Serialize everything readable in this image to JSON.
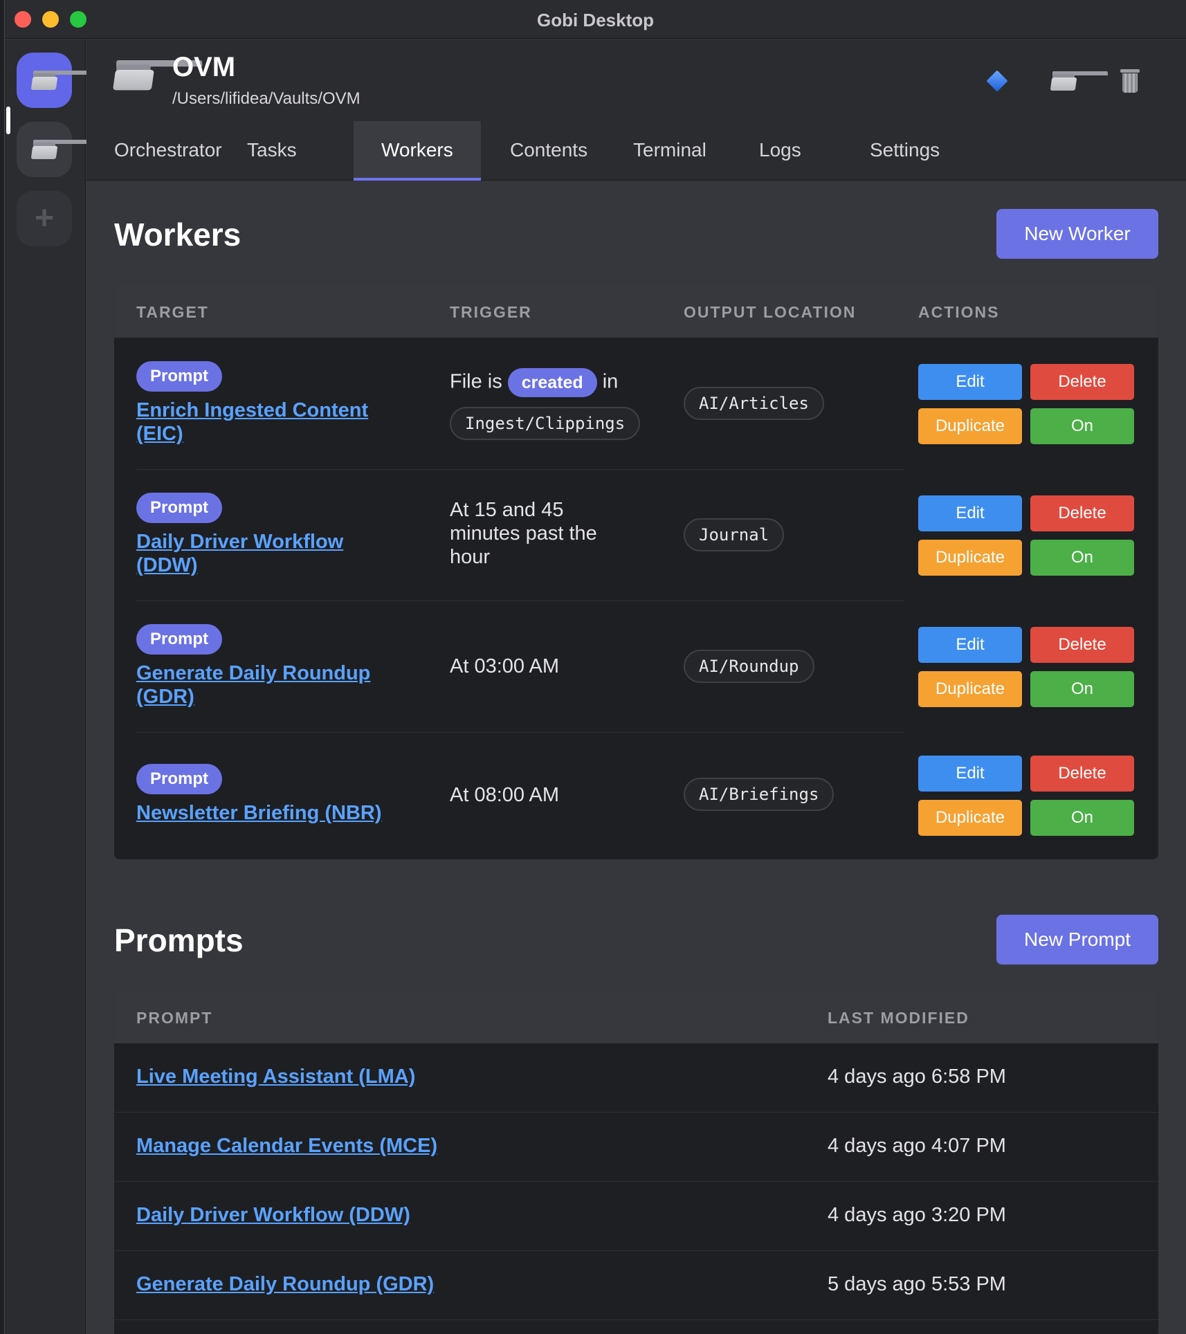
{
  "window": {
    "title": "Gobi Desktop"
  },
  "header": {
    "vault_name": "OVM",
    "vault_path": "/Users/lifidea/Vaults/OVM"
  },
  "tabs": [
    {
      "label": "Orchestrator"
    },
    {
      "label": "Tasks"
    },
    {
      "label": "Workers"
    },
    {
      "label": "Contents"
    },
    {
      "label": "Terminal"
    },
    {
      "label": "Logs"
    },
    {
      "label": "Settings"
    }
  ],
  "workers": {
    "title": "Workers",
    "new_button": "New Worker",
    "columns": {
      "target": "TARGET",
      "trigger": "TRIGGER",
      "output": "OUTPUT LOCATION",
      "actions": "ACTIONS"
    },
    "action_labels": {
      "edit": "Edit",
      "delete": "Delete",
      "duplicate": "Duplicate",
      "toggle": "On"
    },
    "rows": [
      {
        "type": "Prompt",
        "name_line1": "Enrich Ingested Content",
        "name_line2": "(EIC)",
        "trigger_prefix": "File is",
        "trigger_event": "created",
        "trigger_suffix": "in",
        "trigger_folder": "Ingest/Clippings",
        "output": "AI/Articles"
      },
      {
        "type": "Prompt",
        "name_line1": "Daily Driver Workflow",
        "name_line2": "(DDW)",
        "trigger_line1": "At 15 and 45",
        "trigger_line2": "minutes past the",
        "trigger_line3": "hour",
        "output": "Journal"
      },
      {
        "type": "Prompt",
        "name_line1": "Generate Daily Roundup",
        "name_line2": "(GDR)",
        "trigger": "At 03:00 AM",
        "output": "AI/Roundup"
      },
      {
        "type": "Prompt",
        "name": "Newsletter Briefing (NBR)",
        "trigger": "At 08:00 AM",
        "output": "AI/Briefings"
      }
    ]
  },
  "prompts": {
    "title": "Prompts",
    "new_button": "New Prompt",
    "columns": {
      "prompt": "PROMPT",
      "modified": "LAST MODIFIED"
    },
    "rows": [
      {
        "name": "Live Meeting Assistant (LMA)",
        "modified": "4 days ago 6:58 PM"
      },
      {
        "name": "Manage Calendar Events (MCE)",
        "modified": "4 days ago 4:07 PM"
      },
      {
        "name": "Daily Driver Workflow (DDW)",
        "modified": "4 days ago 3:20 PM"
      },
      {
        "name": "Generate Daily Roundup (GDR)",
        "modified": "5 days ago 5:53 PM"
      }
    ]
  }
}
